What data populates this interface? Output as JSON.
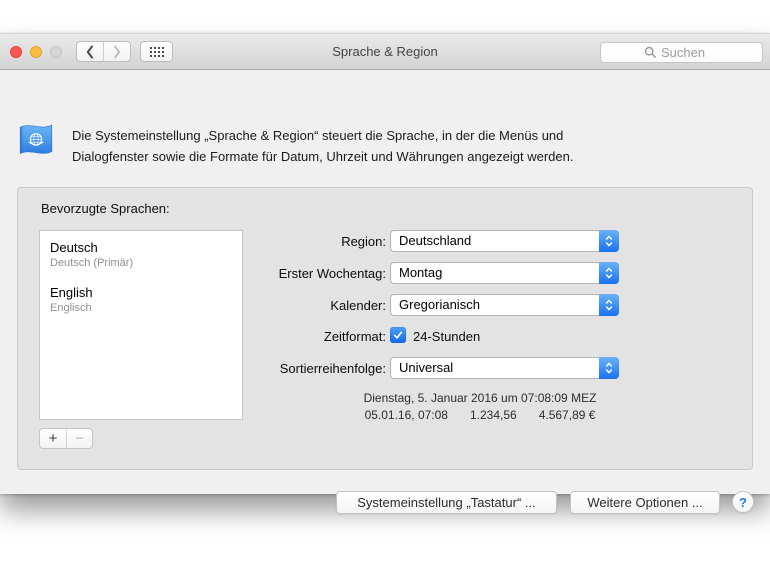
{
  "titlebar": {
    "title": "Sprache & Region",
    "search_placeholder": "Suchen"
  },
  "header": {
    "description_line1": "Die Systemeinstellung „Sprache & Region“ steuert die Sprache, in der die Menüs und",
    "description_line2": "Dialogfenster sowie die Formate für Datum, Uhrzeit und Währungen angezeigt werden."
  },
  "preferred_languages": {
    "label": "Bevorzugte Sprachen:",
    "items": [
      {
        "name": "Deutsch",
        "detail": "Deutsch (Primär)"
      },
      {
        "name": "English",
        "detail": "Englisch"
      }
    ],
    "add_button": "+",
    "remove_button": "−"
  },
  "form": {
    "region": {
      "label": "Region:",
      "value": "Deutschland"
    },
    "first_weekday": {
      "label": "Erster Wochentag:",
      "value": "Montag"
    },
    "calendar": {
      "label": "Kalender:",
      "value": "Gregorianisch"
    },
    "time_format": {
      "label": "Zeitformat:",
      "option": "24-Stunden",
      "checked": true
    },
    "sort_order": {
      "label": "Sortierreihenfolge:",
      "value": "Universal"
    },
    "preview": {
      "full_date": "Dienstag, 5. Januar 2016 um 07:08:09 MEZ",
      "short_date": "05.01.16, 07:08",
      "number": "1.234,56",
      "currency": "4.567,89 €"
    }
  },
  "footer": {
    "keyboard_settings_button": "Systemeinstellung „Tastatur“ ...",
    "more_options_button": "Weitere Optionen ...",
    "help_button": "?"
  },
  "colors": {
    "accent_blue": "#1a70f0",
    "traffic_red": "#fc5753",
    "traffic_yellow": "#fdbc40",
    "traffic_disabled": "#d5d5d5",
    "window_chrome": "#d3d3d3",
    "group_box": "#e3e3e4"
  }
}
